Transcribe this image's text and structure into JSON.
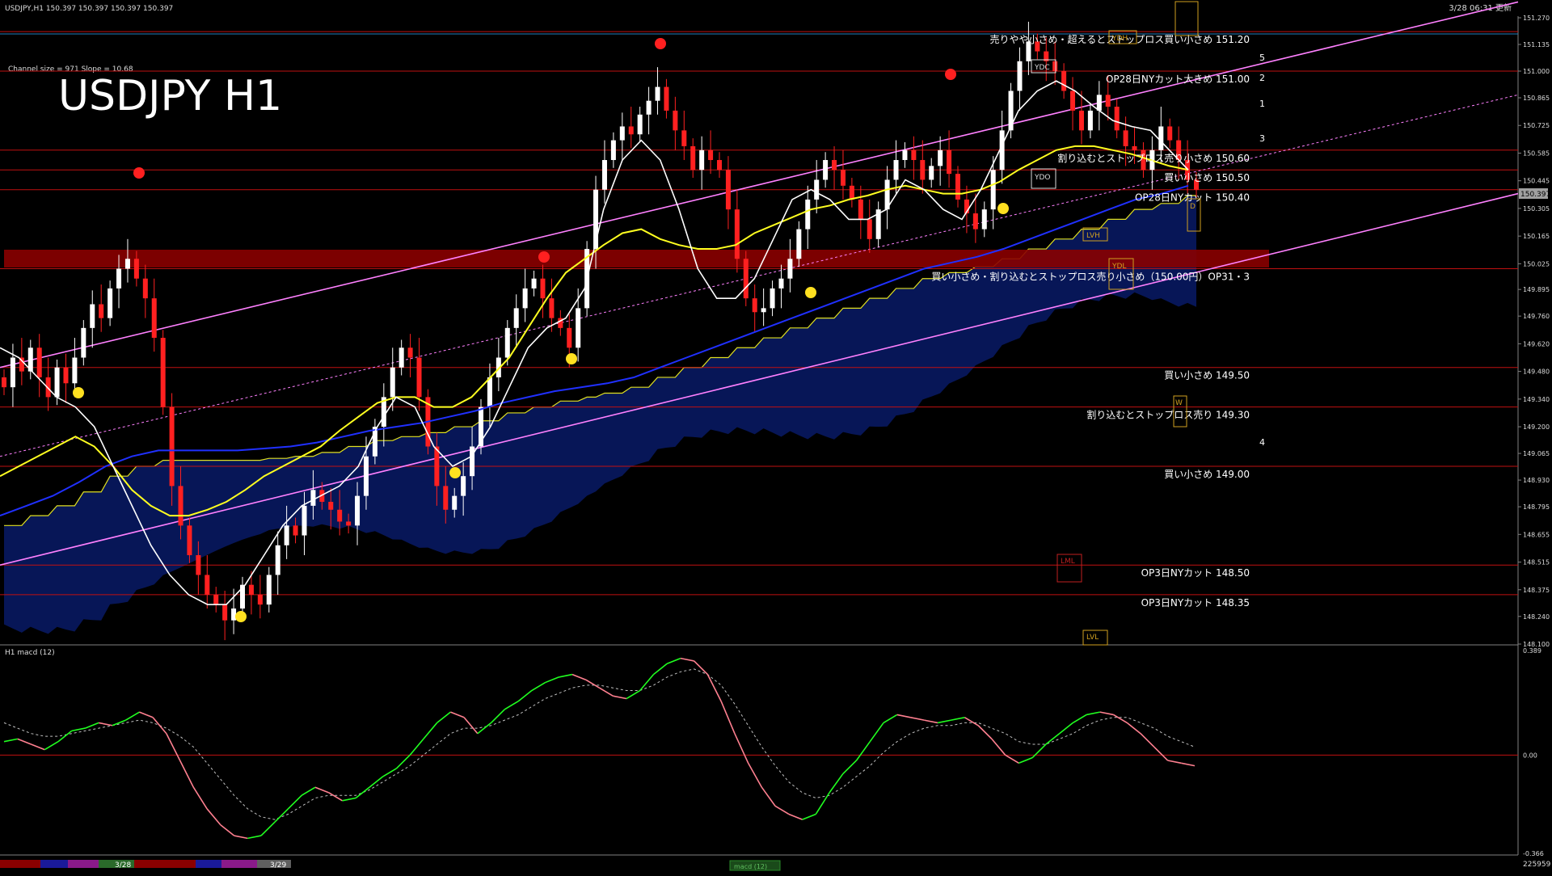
{
  "window": {
    "header_text": "USDJPY,H1  150.397 150.397 150.397 150.397",
    "timestamp": "3/28 06:31 更新",
    "big_title": "USDJPY H1",
    "channel_info": "Channel size = 971 Slope = 10.68"
  },
  "colors": {
    "background": "#000000",
    "bull_candle": "#ffffff",
    "bear_candle": "#ff2020",
    "level_line": "#c01010",
    "ma_fast": "#ffffff",
    "ma_mid": "#ffff20",
    "ma_slow": "#2030ff",
    "channel": "#ff80ff",
    "kumo": "#1030c0",
    "macd_up": "#20ff20",
    "macd_down": "#ff8090",
    "signal": "#c0c0c0",
    "price_box": "#a0a0a0"
  },
  "chart_data": [
    {
      "type": "candlestick",
      "name": "USDJPY H1",
      "ylim": [
        148.1,
        151.27
      ],
      "y_ticks": [
        "151.270",
        "151.135",
        "151.000",
        "150.865",
        "150.725",
        "150.585",
        "150.445",
        "150.305",
        "150.165",
        "150.025",
        "149.895",
        "149.760",
        "149.620",
        "149.480",
        "149.340",
        "149.200",
        "149.065",
        "148.930",
        "148.795",
        "148.655",
        "148.515",
        "148.375",
        "148.240",
        "148.100"
      ],
      "current_price": "150.397",
      "levels": [
        {
          "price": 151.2,
          "label": "売りやや小さめ・超えるとストップロス買い小さめ 151.20"
        },
        {
          "price": 151.0,
          "label": "OP28日NYカット大きめ 151.00"
        },
        {
          "price": 150.6,
          "label": "割り込むとストップロス売り小さめ 150.60"
        },
        {
          "price": 150.5,
          "label": "買い小さめ 150.50"
        },
        {
          "price": 150.4,
          "label": "OP28日NYカット 150.40"
        },
        {
          "price": 150.0,
          "label": "買い小さめ・割り込むとストップロス売り小さめ（150.00円）OP31・3"
        },
        {
          "price": 149.5,
          "label": "買い小さめ 149.50"
        },
        {
          "price": 149.3,
          "label": "割り込むとストップロス売り 149.30"
        },
        {
          "price": 149.0,
          "label": "買い小さめ 149.00"
        },
        {
          "price": 148.5,
          "label": "OP3日NYカット 148.50"
        },
        {
          "price": 148.35,
          "label": "OP3日NYカット 148.35"
        }
      ],
      "close_series": [
        149.4,
        149.55,
        149.48,
        149.6,
        149.45,
        149.35,
        149.5,
        149.42,
        149.55,
        149.7,
        149.82,
        149.75,
        149.9,
        150.0,
        150.05,
        149.95,
        149.85,
        149.65,
        149.3,
        148.9,
        148.7,
        148.55,
        148.45,
        148.35,
        148.3,
        148.22,
        148.28,
        148.4,
        148.35,
        148.3,
        148.45,
        148.6,
        148.7,
        148.65,
        148.8,
        148.88,
        148.82,
        148.78,
        148.72,
        148.7,
        148.85,
        149.05,
        149.2,
        149.35,
        149.5,
        149.6,
        149.55,
        149.35,
        149.1,
        148.9,
        148.78,
        148.85,
        148.95,
        149.1,
        149.3,
        149.45,
        149.55,
        149.7,
        149.8,
        149.9,
        149.95,
        149.85,
        149.75,
        149.7,
        149.6,
        149.8,
        150.1,
        150.4,
        150.55,
        150.65,
        150.72,
        150.68,
        150.78,
        150.85,
        150.92,
        150.8,
        150.7,
        150.62,
        150.5,
        150.6,
        150.55,
        150.5,
        150.3,
        150.05,
        149.85,
        149.78,
        149.8,
        149.9,
        149.95,
        150.05,
        150.2,
        150.35,
        150.45,
        150.55,
        150.5,
        150.42,
        150.35,
        150.25,
        150.15,
        150.3,
        150.45,
        150.55,
        150.6,
        150.55,
        150.45,
        150.52,
        150.6,
        150.48,
        150.35,
        150.28,
        150.2,
        150.3,
        150.5,
        150.7,
        150.9,
        151.05,
        151.15,
        151.1,
        151.05,
        151.0,
        150.9,
        150.8,
        150.7,
        150.8,
        150.88,
        150.82,
        150.7,
        150.62,
        150.6,
        150.5,
        150.6,
        150.72,
        150.65,
        150.55,
        150.45,
        150.4
      ],
      "ma_fast": [
        149.6,
        149.55,
        149.45,
        149.35,
        149.3,
        149.2,
        149.0,
        148.8,
        148.6,
        148.45,
        148.35,
        148.3,
        148.3,
        148.4,
        148.55,
        148.7,
        148.8,
        148.85,
        148.9,
        149.0,
        149.2,
        149.35,
        149.3,
        149.1,
        149.0,
        149.05,
        149.2,
        149.4,
        149.6,
        149.7,
        149.75,
        149.9,
        150.3,
        150.55,
        150.65,
        150.55,
        150.3,
        150.0,
        149.85,
        149.85,
        149.95,
        150.15,
        150.35,
        150.4,
        150.35,
        150.25,
        150.25,
        150.3,
        150.45,
        150.4,
        150.3,
        150.25,
        150.4,
        150.6,
        150.8,
        150.9,
        150.95,
        150.9,
        150.82,
        150.75,
        150.72,
        150.7,
        150.6,
        150.5
      ],
      "ma_mid": [
        148.95,
        149.0,
        149.05,
        149.1,
        149.15,
        149.1,
        149.0,
        148.88,
        148.8,
        148.75,
        148.75,
        148.78,
        148.82,
        148.88,
        148.95,
        149.0,
        149.05,
        149.1,
        149.18,
        149.25,
        149.32,
        149.35,
        149.35,
        149.3,
        149.3,
        149.35,
        149.45,
        149.55,
        149.7,
        149.85,
        149.98,
        150.05,
        150.12,
        150.18,
        150.2,
        150.15,
        150.12,
        150.1,
        150.1,
        150.12,
        150.18,
        150.22,
        150.26,
        150.3,
        150.32,
        150.35,
        150.37,
        150.4,
        150.42,
        150.4,
        150.38,
        150.38,
        150.4,
        150.44,
        150.5,
        150.55,
        150.6,
        150.62,
        150.62,
        150.6,
        150.58,
        150.55,
        150.52,
        150.5
      ],
      "ma_slow": [
        148.75,
        148.8,
        148.85,
        148.92,
        149.0,
        149.05,
        149.08,
        149.08,
        149.08,
        149.08,
        149.09,
        149.1,
        149.12,
        149.15,
        149.18,
        149.2,
        149.22,
        149.25,
        149.28,
        149.32,
        149.35,
        149.38,
        149.4,
        149.42,
        149.45,
        149.5,
        149.55,
        149.6,
        149.65,
        149.7,
        149.75,
        149.8,
        149.85,
        149.9,
        149.95,
        150.0,
        150.03,
        150.06,
        150.1,
        150.15,
        150.2,
        150.25,
        150.3,
        150.35,
        150.38,
        150.42
      ],
      "channel_upper": [
        149.5,
        151.35
      ],
      "channel_lower": [
        148.5,
        150.38
      ],
      "channel_mid": [
        149.05,
        150.88
      ]
    },
    {
      "type": "line",
      "name": "H1 macd (12)",
      "ylim": [
        -0.366,
        0.389
      ],
      "y_ticks": [
        "0.389",
        "0.00",
        "-0.366"
      ],
      "macd": [
        0.05,
        0.06,
        0.04,
        0.02,
        0.05,
        0.09,
        0.1,
        0.12,
        0.11,
        0.13,
        0.16,
        0.14,
        0.08,
        -0.02,
        -0.12,
        -0.2,
        -0.26,
        -0.3,
        -0.31,
        -0.3,
        -0.25,
        -0.2,
        -0.15,
        -0.12,
        -0.14,
        -0.17,
        -0.16,
        -0.12,
        -0.08,
        -0.05,
        0.0,
        0.06,
        0.12,
        0.16,
        0.14,
        0.08,
        0.12,
        0.17,
        0.2,
        0.24,
        0.27,
        0.29,
        0.3,
        0.28,
        0.25,
        0.22,
        0.21,
        0.24,
        0.3,
        0.34,
        0.36,
        0.35,
        0.3,
        0.2,
        0.08,
        -0.03,
        -0.12,
        -0.19,
        -0.22,
        -0.24,
        -0.22,
        -0.14,
        -0.07,
        -0.02,
        0.05,
        0.12,
        0.15,
        0.14,
        0.13,
        0.12,
        0.13,
        0.14,
        0.11,
        0.06,
        0.0,
        -0.03,
        -0.01,
        0.04,
        0.08,
        0.12,
        0.15,
        0.16,
        0.15,
        0.12,
        0.08,
        0.03,
        -0.02,
        -0.03,
        -0.04
      ],
      "signal": [
        0.12,
        0.1,
        0.08,
        0.07,
        0.07,
        0.08,
        0.09,
        0.1,
        0.11,
        0.12,
        0.13,
        0.12,
        0.1,
        0.07,
        0.03,
        -0.03,
        -0.09,
        -0.15,
        -0.2,
        -0.23,
        -0.24,
        -0.22,
        -0.19,
        -0.16,
        -0.15,
        -0.15,
        -0.15,
        -0.13,
        -0.1,
        -0.07,
        -0.04,
        0.0,
        0.04,
        0.08,
        0.1,
        0.1,
        0.11,
        0.13,
        0.15,
        0.18,
        0.21,
        0.23,
        0.25,
        0.26,
        0.26,
        0.25,
        0.24,
        0.24,
        0.26,
        0.29,
        0.31,
        0.32,
        0.3,
        0.26,
        0.19,
        0.11,
        0.03,
        -0.04,
        -0.1,
        -0.14,
        -0.16,
        -0.15,
        -0.12,
        -0.08,
        -0.04,
        0.01,
        0.05,
        0.08,
        0.1,
        0.11,
        0.11,
        0.12,
        0.12,
        0.1,
        0.08,
        0.05,
        0.04,
        0.04,
        0.06,
        0.08,
        0.11,
        0.13,
        0.14,
        0.14,
        0.12,
        0.1,
        0.07,
        0.05,
        0.03
      ]
    }
  ],
  "annotations": {
    "ydh": "YDH",
    "ydc": "YDC",
    "ydo": "YDO",
    "ydl": "YDL",
    "lvh": "LVH",
    "lml": "LML",
    "lvl": "LVL",
    "w": "W",
    "d": "D",
    "wave_labels": [
      "5",
      "2",
      "1",
      "3",
      "4"
    ]
  },
  "bottom_bar": {
    "date1": "3/28",
    "date2": "3/29",
    "indicator_tab": "macd (12)",
    "right_value": "225959"
  }
}
